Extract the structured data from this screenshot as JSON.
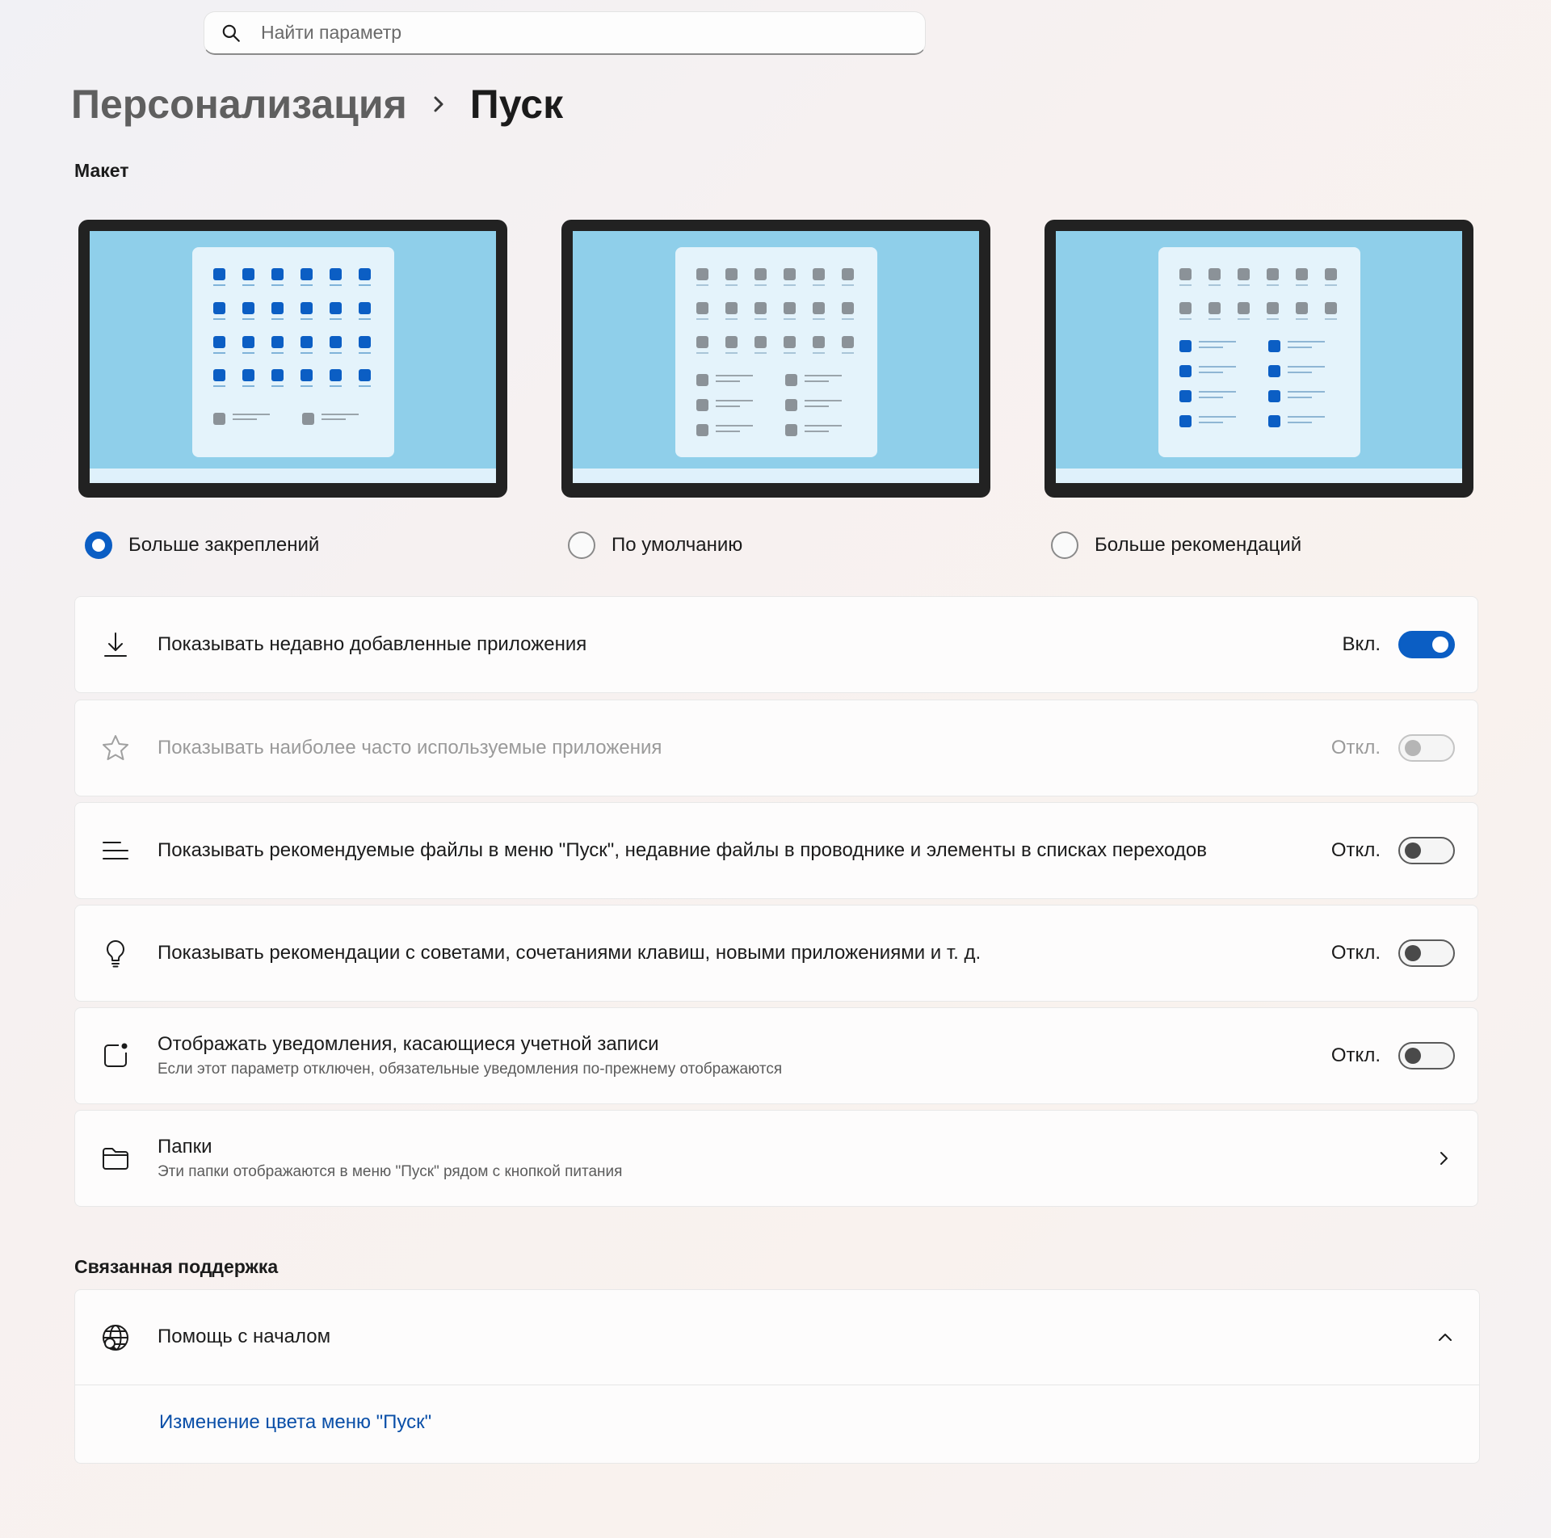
{
  "search": {
    "placeholder": "Найти параметр"
  },
  "breadcrumb": {
    "parent": "Персонализация",
    "current": "Пуск"
  },
  "layout_section": {
    "title": "Макет",
    "options": [
      {
        "label": "Больше закреплений",
        "selected": true
      },
      {
        "label": "По умолчанию",
        "selected": false
      },
      {
        "label": "Больше рекомендаций",
        "selected": false
      }
    ]
  },
  "settings": [
    {
      "icon": "download-icon",
      "title": "Показывать недавно добавленные приложения",
      "state": "Вкл.",
      "on": true,
      "disabled": false
    },
    {
      "icon": "star-icon",
      "title": "Показывать наиболее часто используемые приложения",
      "state": "Откл.",
      "on": false,
      "disabled": true
    },
    {
      "icon": "list-icon",
      "title": "Показывать рекомендуемые файлы в меню \"Пуск\", недавние файлы в проводнике и элементы в списках переходов",
      "state": "Откл.",
      "on": false,
      "disabled": false
    },
    {
      "icon": "lightbulb-icon",
      "title": "Показывать рекомендации с советами, сочетаниями клавиш, новыми приложениями и т. д.",
      "state": "Откл.",
      "on": false,
      "disabled": false
    },
    {
      "icon": "notification-icon",
      "title": "Отображать уведомления, касающиеся учетной записи",
      "subtitle": "Если этот параметр отключен, обязательные уведомления по-прежнему отображаются",
      "state": "Откл.",
      "on": false,
      "disabled": false
    },
    {
      "icon": "folder-icon",
      "title": "Папки",
      "subtitle": "Эти папки отображаются в меню \"Пуск\" рядом с кнопкой питания"
    }
  ],
  "support": {
    "section_title": "Связанная поддержка",
    "title": "Помощь с началом",
    "link": "Изменение цвета меню \"Пуск\"",
    "expanded": true
  },
  "colors": {
    "accent": "#0b5ec4",
    "link": "#0a4fa8",
    "preview_bg": "#8fcfea",
    "preview_frame": "#222222"
  }
}
